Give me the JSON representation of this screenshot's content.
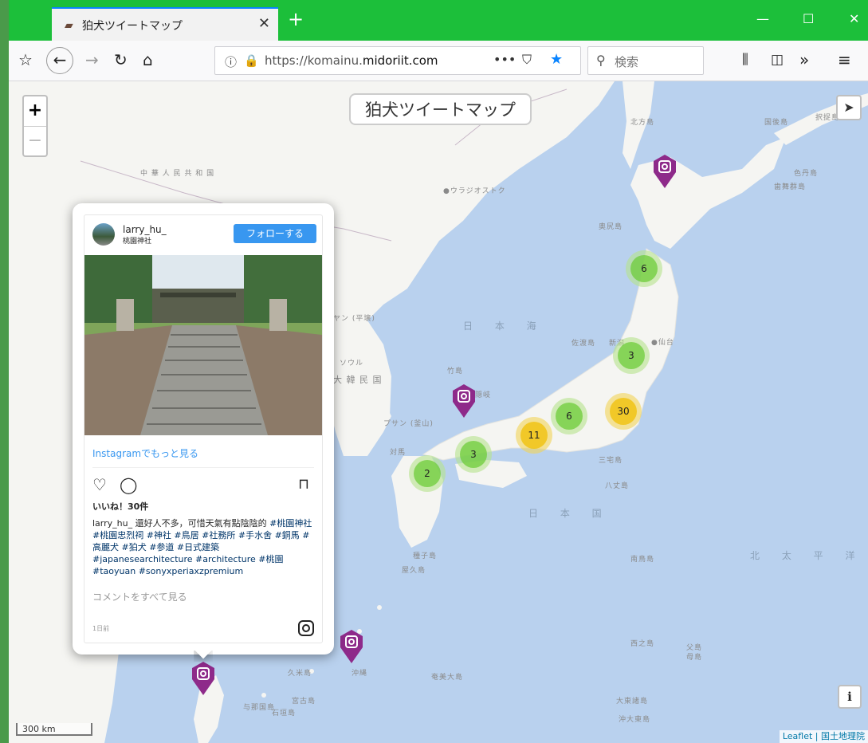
{
  "browser": {
    "tab_title": "狛犬ツイートマップ",
    "tab_close": "✕",
    "new_tab": "+",
    "url_prefix": "https://komainu.",
    "url_domain": "midoriit.com",
    "search_placeholder": "検索",
    "window_min": "—",
    "window_max": "☐",
    "window_close": "✕"
  },
  "map": {
    "title": "狛犬ツイートマップ",
    "zoom_in": "+",
    "zoom_out": "−",
    "info": "i",
    "scale": "300 km",
    "attribution": "Leaflet | 国土地理院",
    "clusters": [
      {
        "count": "6",
        "size": "small"
      },
      {
        "count": "3",
        "size": "small"
      },
      {
        "count": "6",
        "size": "small"
      },
      {
        "count": "30",
        "size": "medium"
      },
      {
        "count": "11",
        "size": "medium"
      },
      {
        "count": "3",
        "size": "small"
      },
      {
        "count": "2",
        "size": "small"
      }
    ],
    "places": [
      "中 華 人 民 共 和 国",
      "●ウラジオストク",
      "北方島",
      "国後島",
      "択捉島",
      "色丹島",
      "歯舞群島",
      "奥尻島",
      "日 本 海",
      "佐渡島",
      "新潟",
      "●仙台",
      "竹島",
      "ソウル",
      "大 韓 民 国",
      "ヤン (平壌)",
      "プサン (釜山)",
      "隠岐",
      "対馬",
      "日 本 国",
      "三宅島",
      "八丈島",
      "種子島",
      "屋久島",
      "奄美大島",
      "沖縄",
      "久米島",
      "宮古島",
      "石垣島",
      "与那国島",
      "西之島",
      "父島",
      "母島",
      "北 太 平 洋",
      "南鳥島",
      "大東諸島",
      "沖大東島"
    ]
  },
  "instagram": {
    "username": "larry_hu_",
    "location": "桃園神社",
    "follow": "フォローする",
    "more": "Instagramでもっと見る",
    "likes": "いいね！30件",
    "caption_user": "larry_hu_",
    "caption_text": " 還好人不多，可惜天氣有點陰陰的 ",
    "caption_tags": "#桃園神社 #桃園忠烈祠 #神社 #鳥居 #社務所 #手水舍 #銅馬 #高麗犬 #狛犬 #参道 #日式建築 #japanesearchitecture #architecture #桃園 #taoyuan #sonyxperiaxzpremium",
    "view_comments": "コメントをすべて見る",
    "time": "1日前"
  }
}
